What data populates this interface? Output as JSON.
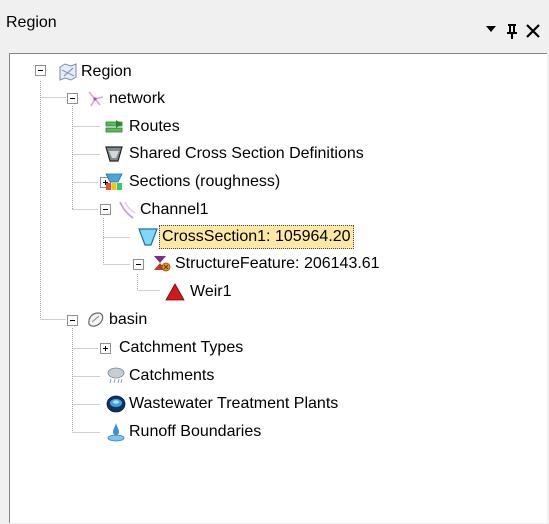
{
  "panel": {
    "title": "Region",
    "icons": {
      "dropdown": "dropdown-arrow-icon",
      "pin": "pin-icon",
      "close": "close-icon"
    }
  },
  "tree": {
    "region": {
      "label": "Region",
      "icon": "region-icon",
      "expanded": true
    },
    "network": {
      "label": "network",
      "icon": "network-icon",
      "expanded": true
    },
    "routes": {
      "label": "Routes",
      "icon": "routes-icon"
    },
    "shared_cross_section_definitions": {
      "label": "Shared Cross Section Definitions",
      "icon": "cross-section-definition-icon"
    },
    "sections_roughness": {
      "label": "Sections (roughness)",
      "icon": "roughness-sections-icon",
      "expanded": false
    },
    "channel1": {
      "label": "Channel1",
      "icon": "channel-icon",
      "expanded": true
    },
    "cross_section1": {
      "label": "CrossSection1: 105964.20",
      "icon": "cross-section-icon",
      "selected": true
    },
    "structure_feature": {
      "label": "StructureFeature: 206143.61",
      "icon": "structure-feature-icon",
      "expanded": true
    },
    "weir1": {
      "label": "Weir1",
      "icon": "weir-icon"
    },
    "basin": {
      "label": "basin",
      "icon": "basin-icon",
      "expanded": true
    },
    "catchment_types": {
      "label": "Catchment Types",
      "expanded": false
    },
    "catchments": {
      "label": "Catchments",
      "icon": "catchment-icon"
    },
    "wastewater_treatment_plants": {
      "label": "Wastewater Treatment Plants",
      "icon": "wastewater-treatment-plant-icon"
    },
    "runoff_boundaries": {
      "label": "Runoff Boundaries",
      "icon": "runoff-boundary-icon"
    }
  },
  "colors": {
    "selection_background": "#ffe8a6",
    "tree_background": "#ffffff",
    "panel_background": "#f0f0f0"
  }
}
